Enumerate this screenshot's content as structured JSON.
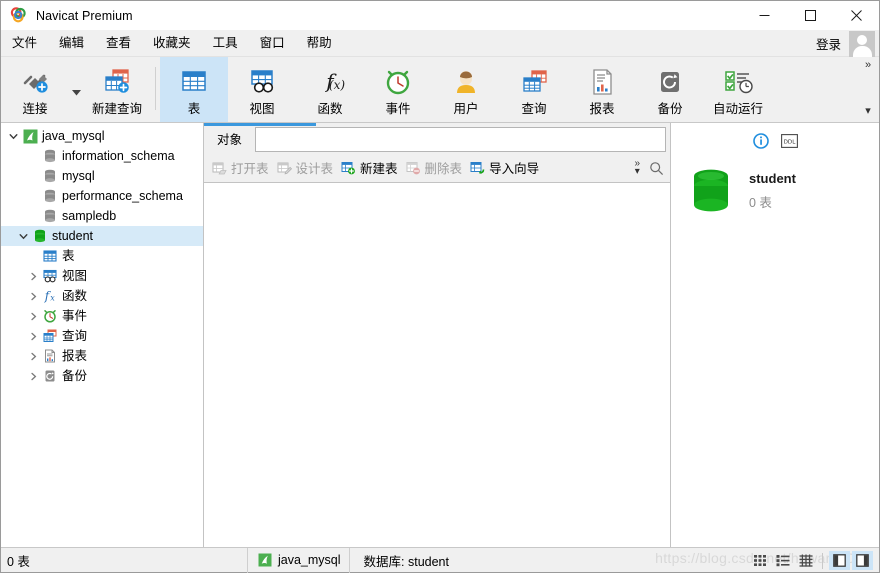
{
  "window": {
    "title": "Navicat Premium",
    "logo_icon": "navicat-logo-icon",
    "minimize_label": "─",
    "maximize_label": "□",
    "close_label": "✕"
  },
  "menubar": {
    "items": [
      {
        "label": "文件",
        "name": "menu-file"
      },
      {
        "label": "编辑",
        "name": "menu-edit"
      },
      {
        "label": "查看",
        "name": "menu-view"
      },
      {
        "label": "收藏夹",
        "name": "menu-favorites"
      },
      {
        "label": "工具",
        "name": "menu-tools"
      },
      {
        "label": "窗口",
        "name": "menu-window"
      },
      {
        "label": "帮助",
        "name": "menu-help"
      }
    ],
    "login_label": "登录",
    "avatar_icon": "user-avatar-icon"
  },
  "ribbon": {
    "overflow_label": "»",
    "overflow_caret": "▾",
    "connect_caret": "▾",
    "buttons": [
      {
        "label": "连接",
        "icon": "connection-icon",
        "name": "ribbon-connection",
        "active": false
      },
      {
        "label": "新建查询",
        "icon": "new-query-icon",
        "name": "ribbon-new-query",
        "active": false
      },
      {
        "label": "表",
        "icon": "table-icon",
        "name": "ribbon-table",
        "active": true
      },
      {
        "label": "视图",
        "icon": "view-icon",
        "name": "ribbon-view",
        "active": false
      },
      {
        "label": "函数",
        "icon": "function-icon",
        "name": "ribbon-function",
        "active": false
      },
      {
        "label": "事件",
        "icon": "event-icon",
        "name": "ribbon-event",
        "active": false
      },
      {
        "label": "用户",
        "icon": "user-icon",
        "name": "ribbon-user",
        "active": false
      },
      {
        "label": "查询",
        "icon": "query-icon",
        "name": "ribbon-query",
        "active": false
      },
      {
        "label": "报表",
        "icon": "report-icon",
        "name": "ribbon-report",
        "active": false
      },
      {
        "label": "备份",
        "icon": "backup-icon",
        "name": "ribbon-backup",
        "active": false
      },
      {
        "label": "自动运行",
        "icon": "automation-icon",
        "name": "ribbon-automation",
        "active": false
      }
    ]
  },
  "sidebar": {
    "nodes": [
      {
        "label": "java_mysql",
        "icon": "connection-node-icon",
        "indent": 0,
        "twisty": "expanded",
        "selected": false
      },
      {
        "label": "information_schema",
        "icon": "database-icon",
        "indent": 1,
        "twisty": "none",
        "selected": false
      },
      {
        "label": "mysql",
        "icon": "database-icon",
        "indent": 1,
        "twisty": "none",
        "selected": false
      },
      {
        "label": "performance_schema",
        "icon": "database-icon",
        "indent": 1,
        "twisty": "none",
        "selected": false
      },
      {
        "label": "sampledb",
        "icon": "database-icon",
        "indent": 1,
        "twisty": "none",
        "selected": false
      },
      {
        "label": "student",
        "icon": "database-open-icon",
        "indent": 1,
        "twisty": "expanded",
        "selected": true
      },
      {
        "label": "表",
        "icon": "table-icon",
        "indent": 2,
        "twisty": "none",
        "selected": false
      },
      {
        "label": "视图",
        "icon": "view-icon",
        "indent": 2,
        "twisty": "collapsed",
        "selected": false
      },
      {
        "label": "函数",
        "icon": "function-icon",
        "indent": 2,
        "twisty": "collapsed",
        "selected": false
      },
      {
        "label": "事件",
        "icon": "event-icon",
        "indent": 2,
        "twisty": "collapsed",
        "selected": false
      },
      {
        "label": "查询",
        "icon": "query-icon",
        "indent": 2,
        "twisty": "collapsed",
        "selected": false
      },
      {
        "label": "报表",
        "icon": "report-icon",
        "indent": 2,
        "twisty": "collapsed",
        "selected": false
      },
      {
        "label": "备份",
        "icon": "backup-icon",
        "indent": 2,
        "twisty": "collapsed",
        "selected": false
      }
    ]
  },
  "center": {
    "tab_label": "对象",
    "filter_value": "",
    "filter_placeholder": "",
    "subbar": [
      {
        "label": "打开表",
        "icon": "open-table-icon",
        "name": "open-table-button",
        "disabled": true
      },
      {
        "label": "设计表",
        "icon": "design-table-icon",
        "name": "design-table-button",
        "disabled": true
      },
      {
        "label": "新建表",
        "icon": "new-table-icon",
        "name": "new-table-button",
        "disabled": false
      },
      {
        "label": "删除表",
        "icon": "delete-table-icon",
        "name": "delete-table-button",
        "disabled": true
      },
      {
        "label": "导入向导",
        "icon": "import-wizard-icon",
        "name": "import-wizard-button",
        "disabled": false
      }
    ],
    "overflow_label": "»",
    "overflow_caret": "▾",
    "search_icon": "search-icon"
  },
  "infopanel": {
    "info_icon": "info-icon",
    "ddl_label": "DDL",
    "object_icon": "database-icon",
    "object_name": "student",
    "object_sub": "0 表"
  },
  "statusbar": {
    "left_text": "0 表",
    "connection_icon": "connection-node-icon",
    "connection_name": "java_mysql",
    "database_text": "数据库: student",
    "watermark": "https://blog.csdn.net/howard2005",
    "view_buttons": [
      {
        "name": "grid-view-button",
        "icon": "grid-view-icon",
        "active": false
      },
      {
        "name": "list-view-button",
        "icon": "list-view-icon",
        "active": false
      },
      {
        "name": "detail-view-button",
        "icon": "detail-view-icon",
        "active": false
      },
      {
        "name": "left-pane-toggle",
        "icon": "left-pane-icon",
        "active": true
      },
      {
        "name": "right-pane-toggle",
        "icon": "right-pane-icon",
        "active": true
      }
    ]
  },
  "colors": {
    "accent": "#3b98dd",
    "selection": "#d6eaf8",
    "ribbon_active": "#cce4f7",
    "chrome": "#f0f0f0",
    "db_green": "#11a21a",
    "table_blue": "#2a7fc9"
  }
}
